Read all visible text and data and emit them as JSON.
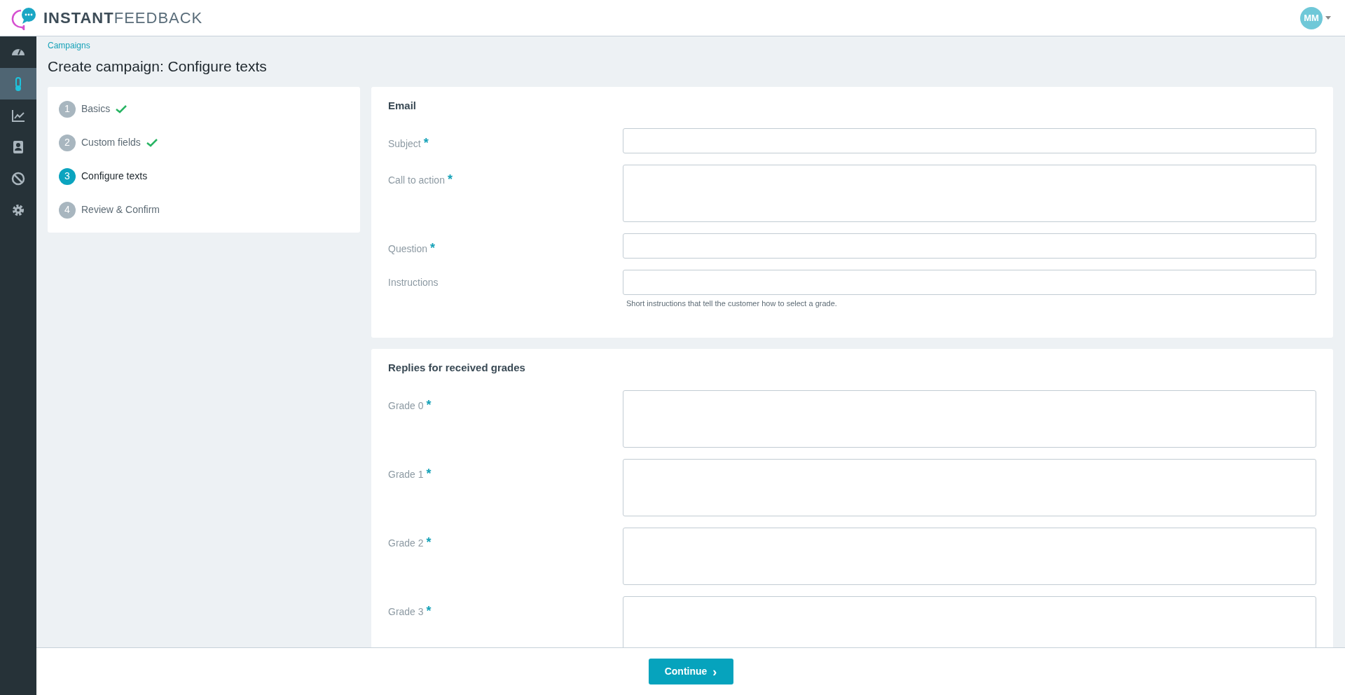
{
  "header": {
    "logo_bold": "INSTANT",
    "logo_light": "FEEDBACK",
    "avatar": "MM"
  },
  "sidebar": {
    "items": [
      {
        "kind": "dashboard",
        "selected": false
      },
      {
        "kind": "campaigns",
        "selected": true
      },
      {
        "kind": "reports",
        "selected": false
      },
      {
        "kind": "contacts",
        "selected": false
      },
      {
        "kind": "blocked",
        "selected": false
      },
      {
        "kind": "settings",
        "selected": false
      }
    ]
  },
  "breadcrumb": "Campaigns",
  "title": "Create campaign: Configure texts",
  "steps": [
    {
      "number": "1",
      "label": "Basics",
      "completed": true,
      "selected": false
    },
    {
      "number": "2",
      "label": "Custom fields",
      "completed": true,
      "selected": false
    },
    {
      "number": "3",
      "label": "Configure texts",
      "completed": false,
      "selected": true
    },
    {
      "number": "4",
      "label": "Review & Confirm",
      "completed": false,
      "selected": false
    }
  ],
  "required_mark": "*",
  "sections": [
    {
      "title": "Email",
      "fields": [
        {
          "label": "Subject",
          "required": true,
          "kind": "input"
        },
        {
          "label": "Call to action",
          "required": true,
          "kind": "textarea"
        },
        {
          "label": "Question",
          "required": true,
          "kind": "input"
        },
        {
          "label": "Instructions",
          "required": false,
          "kind": "input",
          "help": "Short instructions that tell the customer how to select a grade."
        }
      ]
    },
    {
      "title": "Replies for received grades",
      "fields": [
        {
          "label": "Grade 0",
          "required": true,
          "kind": "textarea"
        },
        {
          "label": "Grade 1",
          "required": true,
          "kind": "textarea"
        },
        {
          "label": "Grade 2",
          "required": true,
          "kind": "textarea"
        },
        {
          "label": "Grade 3",
          "required": true,
          "kind": "textarea"
        }
      ]
    }
  ],
  "footer": {
    "button": "Continue",
    "button_icon": "›"
  }
}
